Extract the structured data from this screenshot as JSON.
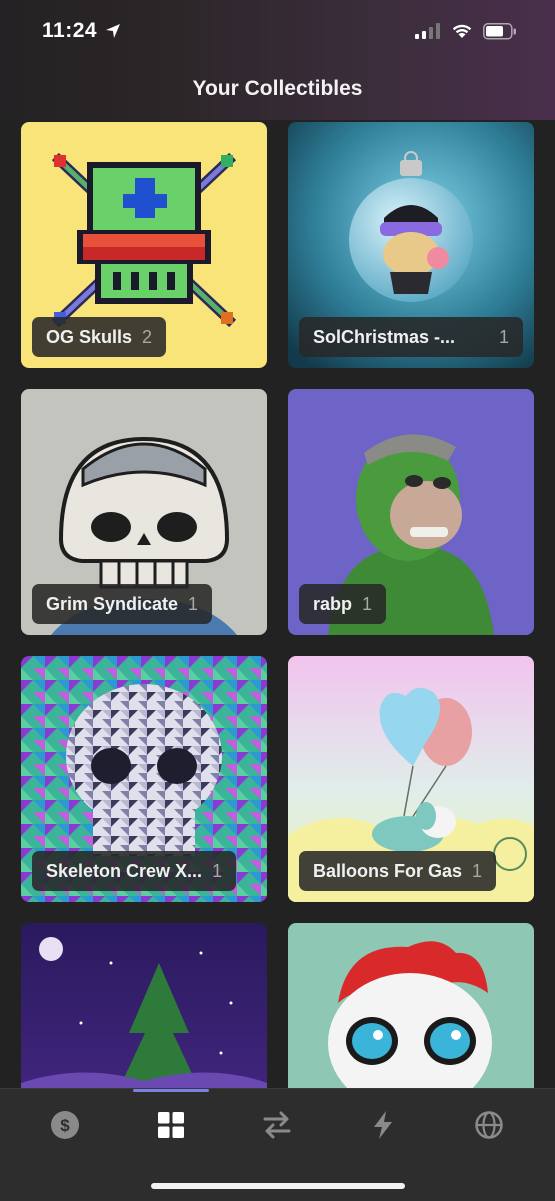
{
  "status": {
    "time": "11:24"
  },
  "header": {
    "title": "Your Collectibles"
  },
  "collectibles": [
    {
      "name": "OG Skulls",
      "count": "2"
    },
    {
      "name": "SolChristmas -...",
      "count": "1"
    },
    {
      "name": "Grim Syndicate",
      "count": "1"
    },
    {
      "name": "rabp",
      "count": "1"
    },
    {
      "name": "Skeleton Crew X...",
      "count": "1"
    },
    {
      "name": "Balloons For Gas",
      "count": "1"
    }
  ],
  "tabbar": {
    "tabs": [
      {
        "icon": "dollar-icon",
        "active": false
      },
      {
        "icon": "grid-icon",
        "active": true
      },
      {
        "icon": "swap-icon",
        "active": false
      },
      {
        "icon": "lightning-icon",
        "active": false
      },
      {
        "icon": "globe-icon",
        "active": false
      }
    ]
  },
  "colors": {
    "accent": "#7b7fe8",
    "background": "#222222",
    "tabbar": "#2d2d2d"
  }
}
